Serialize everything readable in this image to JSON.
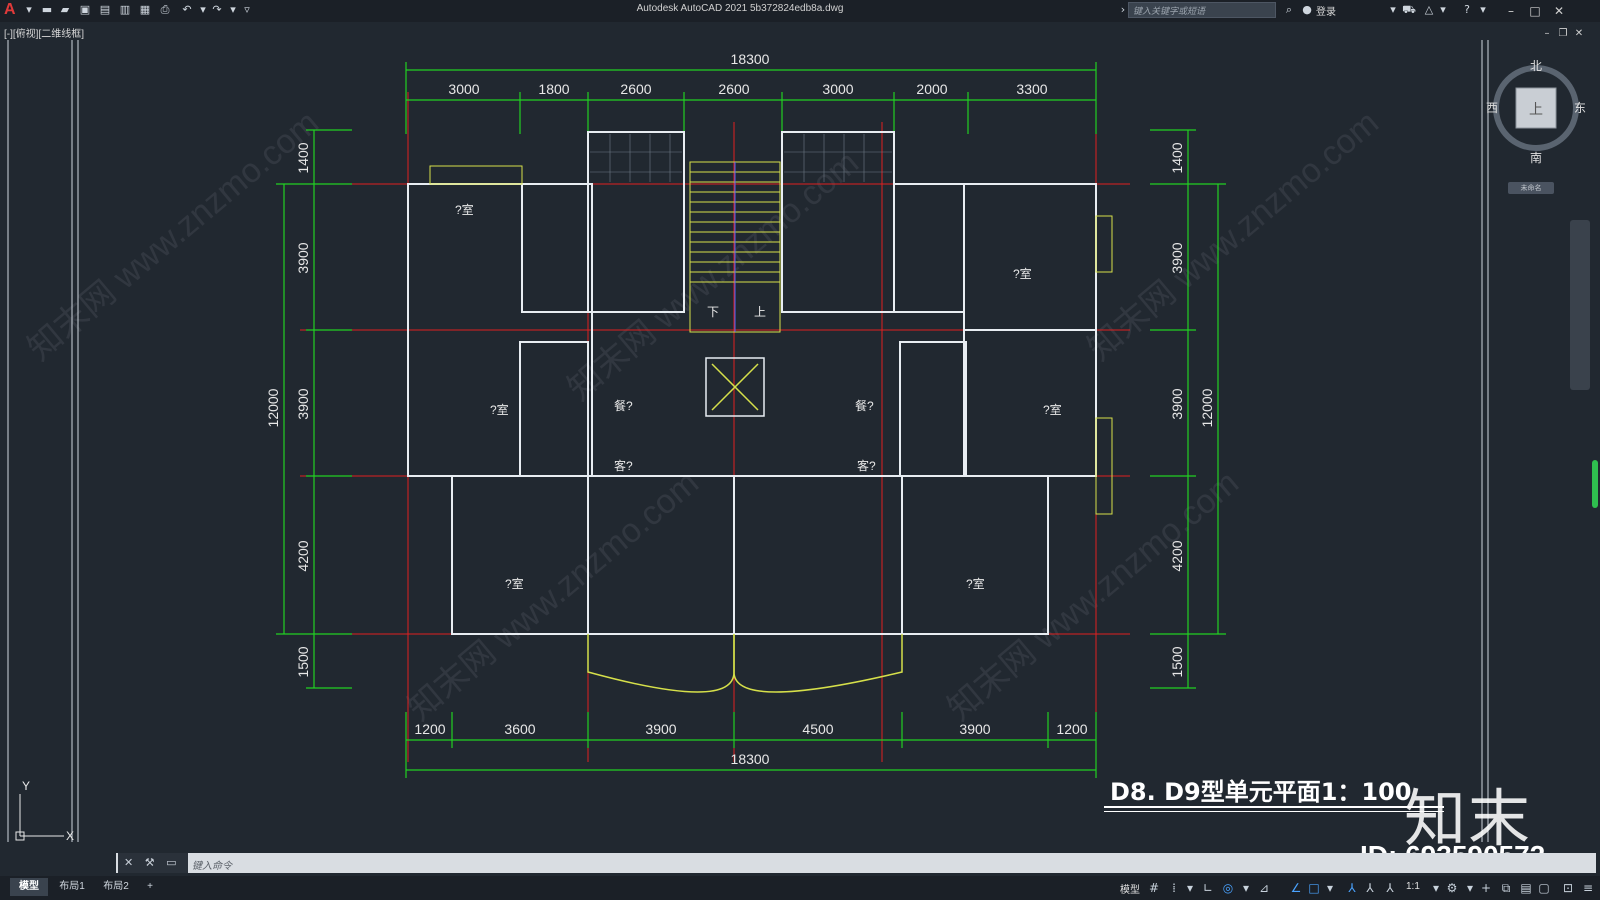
{
  "titlebar": {
    "title": "Autodesk AutoCAD 2021    5b372824edb8a.dwg",
    "search_placeholder": "键入关键字或短语",
    "login_label": "登录"
  },
  "viewport": {
    "label": "[-][俯视][二维线框]"
  },
  "viewcube": {
    "north": "北",
    "south": "南",
    "east": "东",
    "west": "西",
    "face": "上",
    "wcs": "未命名"
  },
  "drawing": {
    "overall_width": "18300",
    "top_dims": [
      "3000",
      "1800",
      "2600",
      "2600",
      "3000",
      "2000",
      "3300"
    ],
    "bottom_dims": [
      "1200",
      "3600",
      "3900",
      "4500",
      "3900",
      "1200"
    ],
    "left_dims": [
      "1400",
      "3900",
      "3900",
      "4200",
      "1500"
    ],
    "right_dims": [
      "1400",
      "3900",
      "3900",
      "4200",
      "1500"
    ],
    "overall_height": "12000",
    "room_labels": {
      "bedroom": "?室",
      "dining": "餐?",
      "living": "客?",
      "stair_down": "下",
      "stair_up": "上"
    },
    "title": "D8. D9型单元平面1：100",
    "axis_x": "X",
    "axis_y": "Y"
  },
  "command_line": {
    "placeholder": "键入命令"
  },
  "layout_tabs": [
    "模型",
    "布局1",
    "布局2",
    "+"
  ],
  "status": {
    "model": "模型",
    "scale": "1:1"
  },
  "watermark": {
    "brand": "知末",
    "id": "ID: 693590572"
  }
}
